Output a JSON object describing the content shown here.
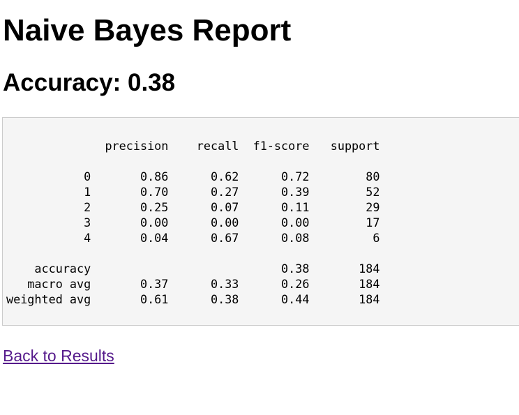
{
  "page_title": "Naive Bayes Report",
  "accuracy_heading": "Accuracy: 0.38",
  "classification_report": "              precision    recall  f1-score   support\n\n           0       0.86      0.62      0.72        80\n           1       0.70      0.27      0.39        52\n           2       0.25      0.07      0.11        29\n           3       0.00      0.00      0.00        17\n           4       0.04      0.67      0.08         6\n\n    accuracy                           0.38       184\n   macro avg       0.37      0.33      0.26       184\nweighted avg       0.61      0.38      0.44       184",
  "back_link_label": "Back to Results",
  "colors": {
    "visited_link": "#551a8b",
    "report_background": "#f5f5f5",
    "report_border": "#cccccc"
  }
}
